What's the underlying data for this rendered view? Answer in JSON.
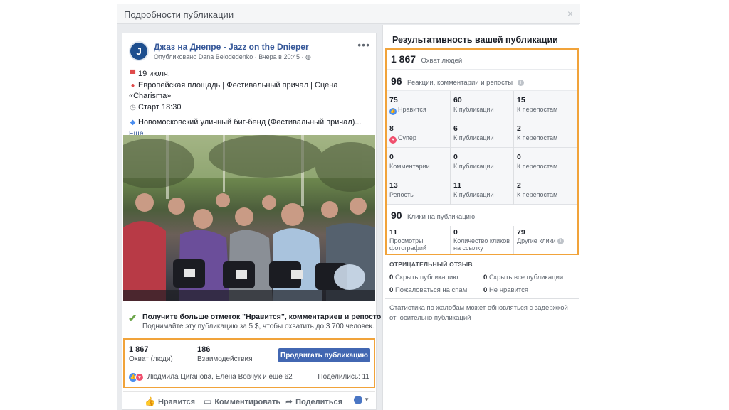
{
  "modal": {
    "title": "Подробности публикации",
    "close_icon": "×"
  },
  "post": {
    "page_name": "Джаз на Днепре - Jazz on the Dnieper",
    "avatar_letter": "J",
    "meta": "Опубликовано Dana Belodedenko · Вчера в 20:45 ·",
    "lines": [
      {
        "icon": "calendar-icon",
        "glyph": "▀",
        "text": "19 июля."
      },
      {
        "icon": "pin-icon",
        "glyph": "📍",
        "text": "Европейская площадь | Фестивальный причал | Сцена"
      },
      {
        "icon": "",
        "glyph": "",
        "text": "«Charisma»"
      },
      {
        "icon": "clock-icon",
        "glyph": "◷",
        "text": "Старт 18:30"
      },
      {
        "icon": "",
        "glyph": "",
        "text": ""
      },
      {
        "icon": "diamond-icon",
        "glyph": "◆",
        "text": "Новомосковский уличный биг-бенд (Фестивальный причал)..."
      }
    ],
    "more": "Ещё"
  },
  "boost": {
    "title": "Получите больше отметок \"Нравится\", комментариев и репостов",
    "subtitle": "Поднимайте эту публикацию за 5 $, чтобы охватить до 3 700 человек."
  },
  "post_stats": {
    "reach_value": "1 867",
    "reach_label": "Охват (люди)",
    "engagement_value": "186",
    "engagement_label": "Взаимодействия",
    "promote_button": "Продвигать публикацию",
    "reactors": "Людмила Циганова, Елена Вовчук и ещё 62",
    "shares": "Поделились: 11"
  },
  "actions": {
    "like": "Нравится",
    "comment": "Комментировать",
    "share": "Поделиться"
  },
  "performance": {
    "title": "Результативность вашей публикации",
    "reach_value": "1 867",
    "reach_label": "Охват людей",
    "reactions_value": "96",
    "reactions_label": "Реакции, комментарии и репосты",
    "grid": [
      [
        {
          "n": "75",
          "l": "Нравится",
          "icon": "like"
        },
        {
          "n": "60",
          "l": "К публикации"
        },
        {
          "n": "15",
          "l": "К перепостам"
        }
      ],
      [
        {
          "n": "8",
          "l": "Супер",
          "icon": "love"
        },
        {
          "n": "6",
          "l": "К публикации"
        },
        {
          "n": "2",
          "l": "К перепостам"
        }
      ],
      [
        {
          "n": "0",
          "l": "Комментарии"
        },
        {
          "n": "0",
          "l": "К публикации"
        },
        {
          "n": "0",
          "l": "К перепостам"
        }
      ],
      [
        {
          "n": "13",
          "l": "Репосты"
        },
        {
          "n": "11",
          "l": "К публикации"
        },
        {
          "n": "2",
          "l": "К перепостам"
        }
      ]
    ],
    "clicks_value": "90",
    "clicks_label": "Клики на публикацию",
    "clicks": [
      {
        "n": "11",
        "l1": "Просмотры",
        "l2": "фотографий"
      },
      {
        "n": "0",
        "l1": "Количество кликов",
        "l2": "на ссылку"
      },
      {
        "n": "79",
        "l1": "Другие клики",
        "l2": ""
      }
    ]
  },
  "negative": {
    "title": "ОТРИЦАТЕЛЬНЫЙ ОТЗЫВ",
    "items": [
      {
        "n": "0",
        "l": "Скрыть публикацию"
      },
      {
        "n": "0",
        "l": "Скрыть все публикации"
      },
      {
        "n": "0",
        "l": "Пожаловаться на спам"
      },
      {
        "n": "0",
        "l": "Не нравится"
      }
    ]
  },
  "note": "Статистика по жалобам может обновляться с задержкой относительно публикаций",
  "colors": {
    "accent": "#4267b2",
    "link": "#365899",
    "highlight": "#f1a33a"
  }
}
